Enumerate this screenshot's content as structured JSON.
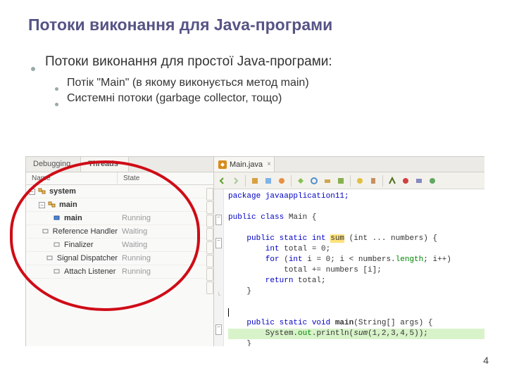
{
  "title": "Потоки виконання для Java-програми",
  "bullets": {
    "main": "Потоки виконання для простої Java-програми:",
    "sub1": "Потік \"Main\" (в якому виконується метод main)",
    "sub2": "Системні потоки (garbage collector, тощо)"
  },
  "ide": {
    "tabs": {
      "debugging": "Debugging",
      "threads": "Threads"
    },
    "cols": {
      "name": "Name",
      "state": "State"
    },
    "tree": {
      "system": "system",
      "mainGrp": "main",
      "rows": [
        {
          "name": "main",
          "state": "Running",
          "bold": true
        },
        {
          "name": "Reference Handler",
          "state": "Waiting"
        },
        {
          "name": "Finalizer",
          "state": "Waiting"
        },
        {
          "name": "Signal Dispatcher",
          "state": "Running"
        },
        {
          "name": "Attach Listener",
          "state": "Running"
        }
      ]
    }
  },
  "editor": {
    "filename": "Main.java",
    "code": {
      "l1": "package javaapplication11;",
      "l2": "",
      "l3a": "public class ",
      "l3b": "Main {",
      "l4": "",
      "l5a": "    public static int ",
      "l5b": "sum",
      "l5c": " (int ... numbers) {",
      "l6a": "        int",
      "l6b": " total = 0;",
      "l7a": "        for",
      "l7b": " (",
      "l7c": "int",
      "l7d": " i = 0; i < numbers.",
      "l7e": "length",
      "l7f": "; i++)",
      "l8": "            total += numbers [i];",
      "l9a": "        return",
      "l9b": " total;",
      "l10": "    }",
      "l13a": "    public static void ",
      "l13b": "main",
      "l13c": "(String[] args) {",
      "l14a": "        System.",
      "l14b": "out",
      "l14c": ".println(",
      "l14d": "sum",
      "l14e": "(1,2,3,4,5));",
      "l15": "    }",
      "l16": "}"
    }
  },
  "page": "4"
}
